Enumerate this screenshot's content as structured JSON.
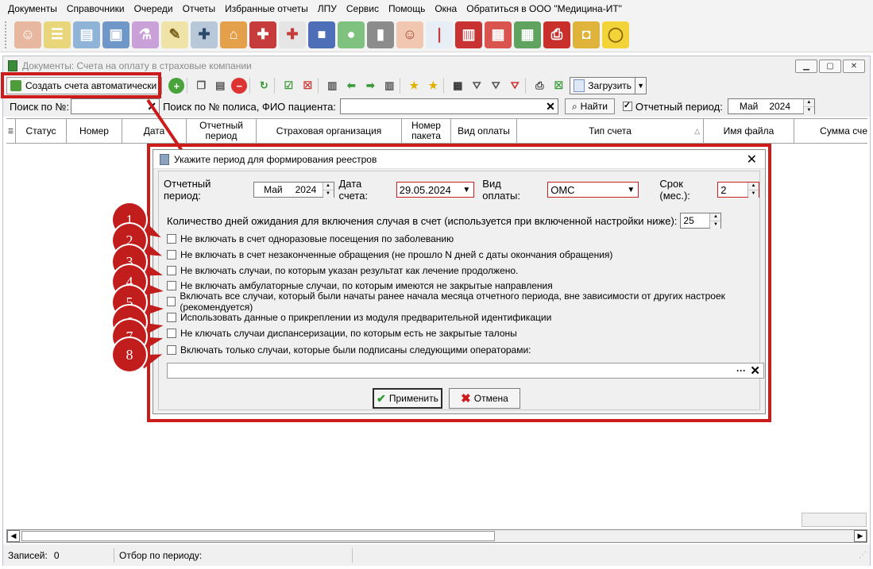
{
  "menu": [
    "Документы",
    "Справочники",
    "Очереди",
    "Отчеты",
    "Избранные отчеты",
    "ЛПУ",
    "Сервис",
    "Помощь",
    "Окна",
    "Обратиться в ООО \"Медицина-ИТ\""
  ],
  "big_toolbar_icons": [
    "doctor-icon",
    "journal-icon",
    "card-index-icon",
    "patient-card-icon",
    "lab-flasks-icon",
    "edit-notes-icon",
    "syringe-icon",
    "hospital-icon",
    "medicine-kit-icon",
    "first-aid-icon",
    "box-icon",
    "pills-icon",
    "barcode-scanner-icon",
    "nurse-icon",
    "thermometer-icon",
    "book-icon",
    "calendar-icon",
    "calculator-icon",
    "print-icon",
    "lock-icon",
    "chat-icon"
  ],
  "window": {
    "title": "Документы: Счета на оплату в страховые компании",
    "create_auto_label": "Создать счета автоматически",
    "load_label": "Загрузить"
  },
  "search": {
    "by_number_label": "Поиск по №:",
    "by_number_value": "",
    "by_policy_label": "Поиск по № полиса, ФИО пациента:",
    "by_policy_value": "",
    "find_label": "Найти",
    "period_checkbox_label": "Отчетный период:",
    "period_checked": true,
    "period_month": "Май",
    "period_year": "2024"
  },
  "grid": {
    "columns": [
      "Статус",
      "Номер",
      "Дата",
      "Отчетный период",
      "Страховая организация",
      "Номер пакета",
      "Вид оплаты",
      "Тип счета",
      "Имя файла",
      "Сумма сче"
    ]
  },
  "status": {
    "records_label": "Записей:",
    "records_value": "0",
    "period_filter_label": "Отбор по периоду:"
  },
  "dialog": {
    "title": "Укажите период для формирования реестров",
    "period_label": "Отчетный период:",
    "period_month": "Май",
    "period_year": "2024",
    "date_label": "Дата счета:",
    "date_value": "29.05.2024",
    "payment_label": "Вид оплаты:",
    "payment_value": "ОМС",
    "term_label": "Срок (мес.):",
    "term_value": "2",
    "wait_days_label": "Количество дней ожидания для включения случая в счет (используется при включенной настройки ниже):",
    "wait_days_value": "25",
    "options": [
      {
        "badge": "1",
        "label": "Не включать в счет одноразовые посещения по заболеванию",
        "checked": false
      },
      {
        "badge": "2",
        "label": "Не включать в счет незаконченные обращения (не прошло N дней с даты окончания обращения)",
        "checked": false
      },
      {
        "badge": "3",
        "label": "Не включать случаи, по которым указан результат как лечение продолжено.",
        "checked": false
      },
      {
        "badge": "4",
        "label": "Не включать амбулаторные случаи, по которым имеются не закрытые направления",
        "checked": false
      },
      {
        "badge": "5",
        "label": "Включать все случаи, который были начаты ранее начала месяца отчетного периода, вне зависимости от других настроек (рекомендуется)",
        "checked": false
      },
      {
        "badge": "6",
        "label": "Использовать данные о прикреплении из модуля предварительной идентификации",
        "checked": false
      },
      {
        "badge": "7",
        "label": "Не ключать случаи диспансеризации, по которым есть не закрытые талоны",
        "checked": false
      },
      {
        "badge": "8",
        "label": "Включать только случаи, которые были подписаны следующими операторами:",
        "checked": false
      }
    ],
    "operators_value": "",
    "apply_label": "Применить",
    "cancel_label": "Отмена"
  }
}
